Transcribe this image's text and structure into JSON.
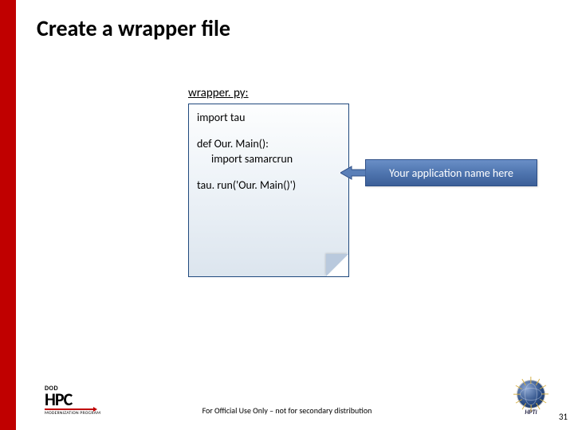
{
  "title": "Create a wrapper file",
  "filename": "wrapper. py:",
  "code": {
    "line1": "import tau",
    "line2": "def Our. Main():",
    "line3": "import samarcrun",
    "line4": "tau. run('Our. Main()')"
  },
  "callout": "Your application name here",
  "footer": "For Official Use Only – not for secondary distribution",
  "page_number": "31",
  "logo_left": {
    "top": "DOD",
    "main": "HPC",
    "bottom": "MODERNIZATION PROGRAM"
  },
  "logo_right": {
    "text": "HPTi"
  }
}
